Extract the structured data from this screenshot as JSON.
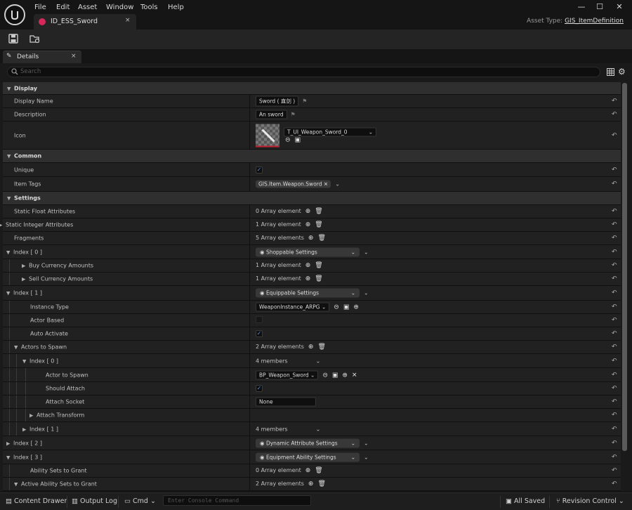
{
  "menu": [
    "File",
    "Edit",
    "Asset",
    "Window",
    "Tools",
    "Help"
  ],
  "doc_tab": {
    "label": "ID_ESS_Sword",
    "close": "×"
  },
  "window_controls": {
    "minimize": "—",
    "maximize": "☐",
    "close": "✕"
  },
  "asset_type": {
    "label": "Asset Type: ",
    "value": "GIS_ItemDefinition"
  },
  "details_tab": {
    "label": "Details",
    "close": "×"
  },
  "search": {
    "placeholder": "Search"
  },
  "rows": [
    {
      "name": "Display",
      "cat": true
    },
    {
      "name": "Display Name",
      "value": "Sword ( 直剑 )",
      "kind": "text-flag"
    },
    {
      "name": "Description",
      "value": "An sword",
      "kind": "text-flag"
    },
    {
      "name": "Icon",
      "value": "T_UI_Weapon_Sword_0",
      "kind": "icon"
    },
    {
      "name": "Common",
      "cat": true
    },
    {
      "name": "Unique",
      "kind": "check"
    },
    {
      "name": "Item Tags",
      "value": "GIS.Item.Weapon.Sword",
      "kind": "tag"
    },
    {
      "name": "Settings",
      "cat": true
    },
    {
      "name": "Static Float Attributes",
      "value": "0 Array element",
      "kind": "array"
    },
    {
      "name": "Static Integer Attributes",
      "value": "1 Array element",
      "kind": "array"
    },
    {
      "name": "Fragments",
      "value": "5 Array elements",
      "kind": "array"
    },
    {
      "name": "Index [ 0 ]",
      "value": "Shoppable Settings",
      "kind": "struct"
    },
    {
      "name": "Buy Currency Amounts",
      "value": "1 Array element",
      "kind": "array"
    },
    {
      "name": "Sell Currency Amounts",
      "value": "1 Array element",
      "kind": "array"
    },
    {
      "name": "Index [ 1 ]",
      "value": "Equippable Settings",
      "kind": "struct"
    },
    {
      "name": "Instance Type",
      "value": "WeaponInstance_ARPG",
      "kind": "class"
    },
    {
      "name": "Actor Based",
      "kind": "check-disabled"
    },
    {
      "name": "Auto Activate",
      "kind": "check"
    },
    {
      "name": "Actors to Spawn",
      "value": "2 Array elements",
      "kind": "array"
    },
    {
      "name": "Index [ 0 ]",
      "value": "4 members",
      "kind": "members"
    },
    {
      "name": "Actor to Spawn",
      "value": "BP_Weapon_Sword",
      "kind": "actor"
    },
    {
      "name": "Should Attach",
      "kind": "check"
    },
    {
      "name": "Attach Socket",
      "value": "None",
      "kind": "socket"
    },
    {
      "name": "Attach Transform",
      "kind": "empty"
    },
    {
      "name": "Index [ 1 ]",
      "value": "4 members",
      "kind": "members"
    },
    {
      "name": "Index [ 2 ]",
      "value": "Dynamic Attribute Settings",
      "kind": "struct"
    },
    {
      "name": "Index [ 3 ]",
      "value": "Equipment Ability Settings",
      "kind": "struct"
    },
    {
      "name": "Ability Sets to Grant",
      "value": "0 Array element",
      "kind": "array"
    },
    {
      "name": "Active Ability Sets to Grant",
      "value": "2 Array elements",
      "kind": "array"
    }
  ],
  "statusbar": {
    "content_drawer": "Content Drawer",
    "output_log": "Output Log",
    "cmd": "Cmd",
    "console_placeholder": "Enter Console Command",
    "all_saved": "All Saved",
    "revision_control": "Revision Control"
  }
}
